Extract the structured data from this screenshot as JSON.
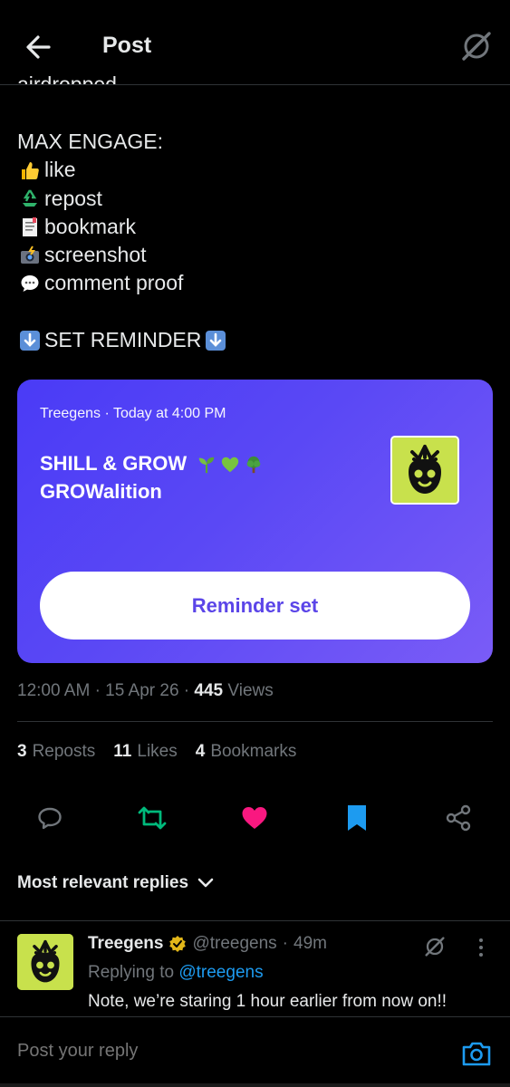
{
  "header": {
    "title": "Post",
    "back_icon": "arrow-left-icon",
    "grok_icon": "grok-slash-icon"
  },
  "post": {
    "cut_text": "airdropped",
    "heading": "MAX ENGAGE:",
    "items": [
      {
        "icon": "thumbs-up-emoji",
        "label": "like"
      },
      {
        "icon": "recycle-emoji",
        "label": "repost"
      },
      {
        "icon": "bookmark-tabs-emoji",
        "label": "bookmark"
      },
      {
        "icon": "camera-flash-emoji",
        "label": "screenshot"
      },
      {
        "icon": "speech-balloon-emoji",
        "label": "comment proof"
      }
    ],
    "reminder_line": "SET REMINDER",
    "reminder_icon": "down-arrow-emoji"
  },
  "card": {
    "host": "Treegens",
    "separator": "·",
    "time": "Today at 4:00 PM",
    "title_line1": "SHILL & GROW",
    "title_line2": "GROWalition",
    "title_emojis": [
      "seedling-emoji",
      "green-heart-emoji",
      "tree-emoji"
    ],
    "button_label": "Reminder set",
    "colors": {
      "gradient_start": "#4a3bf6",
      "gradient_end": "#7a5cf7",
      "button_text": "#5b45e8"
    }
  },
  "meta": {
    "time": "12:00 AM",
    "date": "15 Apr 26",
    "views_count": "445",
    "views_label": "Views"
  },
  "stats": {
    "reposts_count": "3",
    "reposts_label": "Reposts",
    "likes_count": "11",
    "likes_label": "Likes",
    "bookmarks_count": "4",
    "bookmarks_label": "Bookmarks"
  },
  "actions": {
    "reply_icon": "reply-bubble-icon",
    "repost_icon": "repost-icon",
    "like_icon": "heart-icon",
    "bookmark_icon": "bookmark-icon",
    "share_icon": "share-icon",
    "colors": {
      "muted": "#71767b",
      "repost": "#00ba7c",
      "like": "#f91880",
      "bookmark": "#1d9bf0"
    }
  },
  "replies_filter": {
    "label": "Most relevant replies"
  },
  "reply": {
    "name": "Treegens",
    "verified_badge": "gold-verified-icon",
    "handle": "@treegens",
    "time": "49m",
    "replying_prefix": "Replying to",
    "mention": "@treegens",
    "text": "Note, we’re staring 1 hour earlier from now on!!"
  },
  "compose": {
    "placeholder": "Post your reply",
    "camera_icon": "camera-icon"
  },
  "theme": {
    "background": "#000000",
    "text": "#e7e9ea",
    "muted": "#71767b",
    "divider": "#2f3336",
    "link": "#1d9bf0"
  }
}
